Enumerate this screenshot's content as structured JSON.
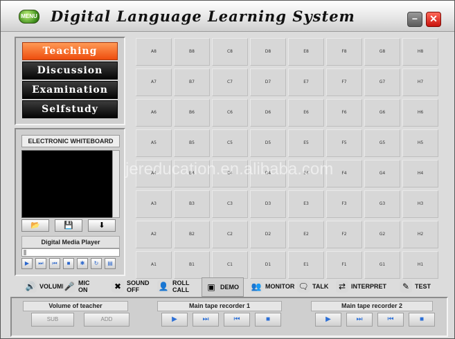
{
  "window": {
    "menu_label": "MENU",
    "title": "Digital Language Learning System",
    "min_label": "−",
    "close_label": "✕"
  },
  "modes": [
    {
      "label": "Teaching",
      "active": true
    },
    {
      "label": "Discussion",
      "active": false
    },
    {
      "label": "Examination",
      "active": false
    },
    {
      "label": "Selfstudy",
      "active": false
    }
  ],
  "whiteboard": {
    "title": "ELECTRONIC WHITEBOARD",
    "tools": [
      "open-folder-icon",
      "save-icon",
      "download-arrow-icon"
    ],
    "tool_glyphs": [
      "📂",
      "💾",
      "⬇"
    ]
  },
  "media_player": {
    "title": "Digital Media Player",
    "buttons": [
      {
        "icon": "play-icon",
        "glyph": "▶"
      },
      {
        "icon": "next-icon",
        "glyph": "⏭"
      },
      {
        "icon": "previous-icon",
        "glyph": "⏮"
      },
      {
        "icon": "stop-icon",
        "glyph": "■"
      },
      {
        "icon": "settings-icon",
        "glyph": "✱"
      },
      {
        "icon": "refresh-icon",
        "glyph": "↻"
      },
      {
        "icon": "file-icon",
        "glyph": "▤"
      }
    ]
  },
  "seats": {
    "columns": [
      "A",
      "B",
      "C",
      "D",
      "E",
      "F",
      "G",
      "H"
    ],
    "rows": [
      8,
      7,
      6,
      5,
      4,
      3,
      2,
      1
    ]
  },
  "watermark": "jereducation.en.alibaba.com",
  "toolbar": [
    {
      "icon": "volume-icon",
      "glyph": "🔊",
      "label": "VOLUME",
      "color": "#d9d9d9"
    },
    {
      "icon": "mic-icon",
      "glyph": "🎤",
      "label": "MIC\nON",
      "color": "#d9d9d9"
    },
    {
      "icon": "sound-off-icon",
      "glyph": "✖",
      "label": "SOUND\nOFF",
      "color": "#d9d9d9"
    },
    {
      "icon": "roll-call-icon",
      "glyph": "👤",
      "label": "ROLL\nCALL",
      "color": "#d9d9d9"
    },
    {
      "icon": "demo-icon",
      "glyph": "▣",
      "label": "DEMO",
      "color": "#cfcfcf"
    },
    {
      "icon": "monitor-icon",
      "glyph": "👥",
      "label": "MONITOR",
      "color": "#d9d9d9"
    },
    {
      "icon": "talk-icon",
      "glyph": "🗨",
      "label": "TALK",
      "color": "#d9d9d9"
    },
    {
      "icon": "interpret-icon",
      "glyph": "⇄",
      "label": "INTERPRET",
      "color": "#d9d9d9"
    },
    {
      "icon": "test-icon",
      "glyph": "✎",
      "label": "TEST",
      "color": "#d9d9d9"
    }
  ],
  "volume_group": {
    "title": "Volume of teacher",
    "sub": "SUB",
    "add": "ADD"
  },
  "recorder1": {
    "title": "Main tape recorder 1"
  },
  "recorder2": {
    "title": "Main tape recorder 2"
  },
  "recorder_buttons": [
    {
      "icon": "play-icon",
      "glyph": "▶"
    },
    {
      "icon": "next-icon",
      "glyph": "⏭"
    },
    {
      "icon": "previous-icon",
      "glyph": "⏮"
    },
    {
      "icon": "stop-icon",
      "glyph": "■"
    }
  ]
}
